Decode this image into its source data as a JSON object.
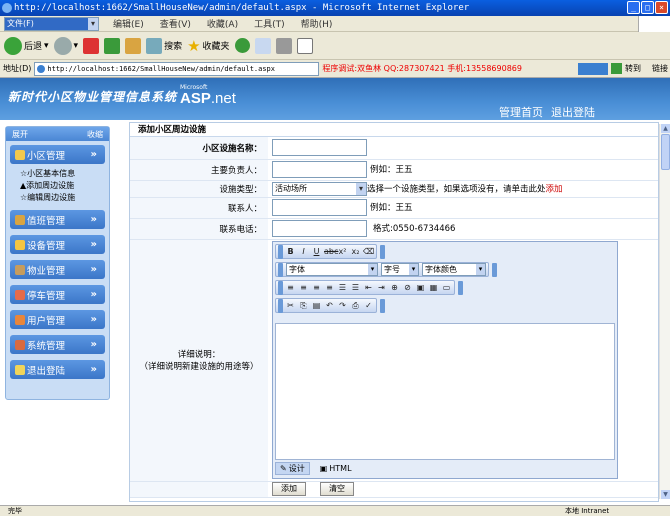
{
  "window": {
    "title": "http://localhost:1662/SmallHouseNew/admin/default.aspx - Microsoft Internet Explorer"
  },
  "menu": [
    "文件(F)",
    "编辑(E)",
    "查看(V)",
    "收藏(A)",
    "工具(T)",
    "帮助(H)"
  ],
  "toolbar": {
    "back": "后退",
    "search": "搜索",
    "favorites": "收藏夹"
  },
  "address": {
    "label": "地址(D)",
    "url": "http://localhost:1662/SmallHouseNew/admin/default.aspx",
    "notice": "程序调试:双鱼林 QQ:287307421 手机:13558690869",
    "go": "转到",
    "links": "链接"
  },
  "header": {
    "system_name": "新时代小区物业管理信息系统",
    "microsoft": "Microsoft",
    "aspnet_a": "ASP",
    "aspnet_b": ".net",
    "nav_home": "管理首页",
    "nav_logout": "退出登陆"
  },
  "sidebar": {
    "expand": "展开",
    "collapse": "收缩",
    "groups": [
      {
        "label": "小区管理",
        "color": "#f2c94c"
      },
      {
        "label": "值班管理",
        "color": "#d9a441"
      },
      {
        "label": "设备管理",
        "color": "#f5c542"
      },
      {
        "label": "物业管理",
        "color": "#c69c5d"
      },
      {
        "label": "停车管理",
        "color": "#e56b4a"
      },
      {
        "label": "用户管理",
        "color": "#e8863c"
      },
      {
        "label": "系统管理",
        "color": "#d86a3f"
      },
      {
        "label": "退出登陆",
        "color": "#f0d45a"
      }
    ],
    "sublinks": [
      "☆小区基本信息",
      "▲添加周边设施",
      "☆编辑周边设施"
    ]
  },
  "form": {
    "section_title": "添加小区周边设施",
    "name_label": "小区设施名称：",
    "person_label": "主要负责人：",
    "person_example": "例如：王五",
    "type_label": "设施类型：",
    "type_value": "活动场所",
    "type_hint": "选择一个设施类型，如果选项没有，请单击此处",
    "type_link": "添加",
    "contact_label": "联系人：",
    "contact_example": "例如：王五",
    "phone_label": "联系电话：",
    "phone_example": "格式:0550-6734466",
    "desc_label": "详细说明：",
    "desc_sub": "（详细说明新建设施的用途等）",
    "font_name": "字体",
    "font_size": "字号",
    "font_color": "字体颜色",
    "tab_design": "设计",
    "tab_html": "HTML",
    "submit": "添加",
    "reset": "清空"
  },
  "status": {
    "left": "完毕",
    "zone": "本地 Intranet"
  }
}
